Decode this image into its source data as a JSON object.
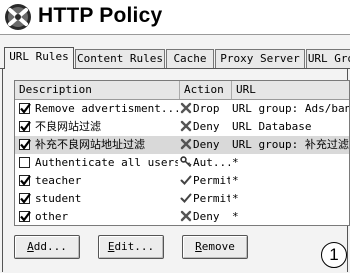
{
  "window": {
    "title": "HTTP Policy",
    "icon": "policy-app-icon"
  },
  "tabs": [
    {
      "label": "URL Rules",
      "active": true
    },
    {
      "label": "Content Rules"
    },
    {
      "label": "Cache"
    },
    {
      "label": "Proxy Server"
    },
    {
      "label": "URL Gro"
    }
  ],
  "table": {
    "columns": [
      "Description",
      "Action",
      "URL"
    ],
    "rows": [
      {
        "checked": true,
        "description": "Remove advertisment...",
        "action": "Drop",
        "action_icon": "deny-x-icon",
        "url": "URL group: Ads/banners"
      },
      {
        "checked": true,
        "description": "不良网站过滤",
        "action": "Deny",
        "action_icon": "deny-x-icon",
        "url": "URL Database"
      },
      {
        "checked": true,
        "description": "补充不良网站地址过滤",
        "action": "Deny",
        "action_icon": "deny-x-icon",
        "url": "URL group: 补充过滤地址",
        "selected": true
      },
      {
        "checked": false,
        "description": "Authenticate all users",
        "action": "Aut...",
        "action_icon": "key-icon",
        "url": "*"
      },
      {
        "checked": true,
        "description": "teacher",
        "action": "Permit",
        "action_icon": "permit-check-icon",
        "url": "*"
      },
      {
        "checked": true,
        "description": "student",
        "action": "Permit",
        "action_icon": "permit-check-icon",
        "url": "*"
      },
      {
        "checked": true,
        "description": "other",
        "action": "Deny",
        "action_icon": "deny-x-icon",
        "url": "*"
      }
    ]
  },
  "buttons": {
    "add": {
      "underline": "A",
      "rest": "dd..."
    },
    "edit": {
      "underline": "E",
      "rest": "dit..."
    },
    "remove": {
      "underline": "R",
      "rest": "emove"
    }
  },
  "annotation": "1",
  "colors": {
    "selected_row": "#d9d9d9",
    "deny": "#555555",
    "permit": "#444444"
  }
}
